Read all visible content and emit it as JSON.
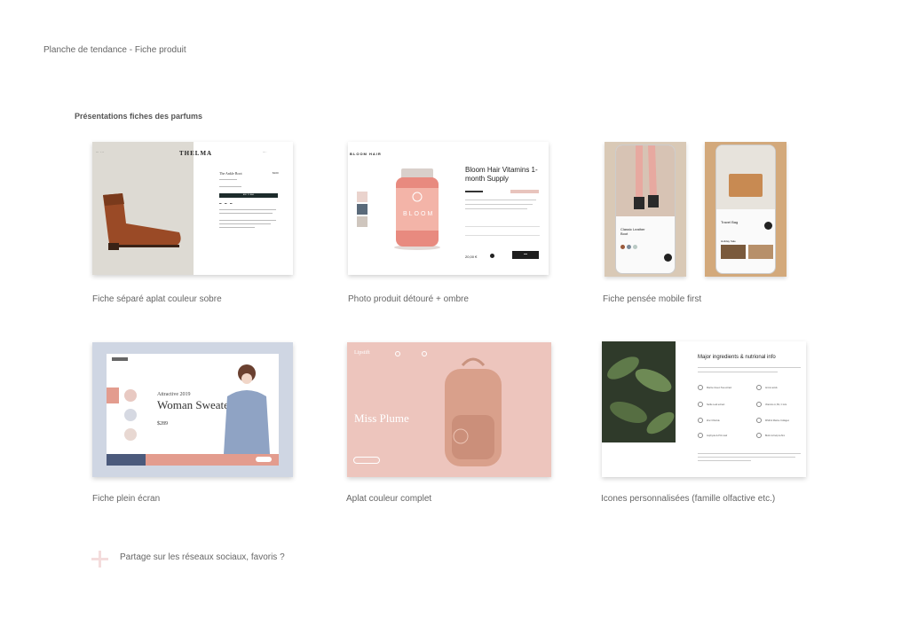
{
  "page_title": "Planche de tendance - Fiche produit",
  "section_title": "Présentations fiches des parfums",
  "cards": [
    {
      "caption": "Fiche séparé aplat couleur sobre",
      "brand": "THELMA",
      "product_title": "The Ankle Boot",
      "price": "$100",
      "add_button": "ADD TO BAG",
      "accent": "#dddad3"
    },
    {
      "caption": "Photo produit détouré + ombre",
      "brand": "BLOOM HAIR",
      "product_title": "Bloom Hair Vitamins 1-month Supply",
      "jar_label": "BLOOM",
      "price": "20,00 €",
      "accent": "#e88a7f"
    },
    {
      "caption": "Fiche pensée mobile first",
      "screen1_title": "Classic Leather Boot",
      "screen2_title": "Travel Bag",
      "screen2_section": "Holiday Sale",
      "accent": "#d3a97b"
    },
    {
      "caption": "Fiche plein écran",
      "small_title": "Attractive 2019",
      "title": "Woman Sweater",
      "price": "$289",
      "accent": "#e39c8e"
    },
    {
      "caption": "Aplat couleur complet",
      "brand": "Lipstift",
      "title": "Miss Plume",
      "accent": "#edc5bd"
    },
    {
      "caption": "Icones personnalisées (famille olfactive etc.)",
      "title": "Major ingredients & nutrional info",
      "ingredients": [
        "Marine Green Tea extract",
        "Amino acids",
        "Nettle Leaf extract",
        "Vitamins A, B1, C & E",
        "Zinc Chloride",
        "MSM & Marine Collagen",
        "Asphyxia & Prim leaf",
        "Biotin & Kelp & Zinc"
      ]
    }
  ],
  "footer_text": "Partage sur les réseaux sociaux, favoris ?",
  "plus_color": "#f4dcdc"
}
